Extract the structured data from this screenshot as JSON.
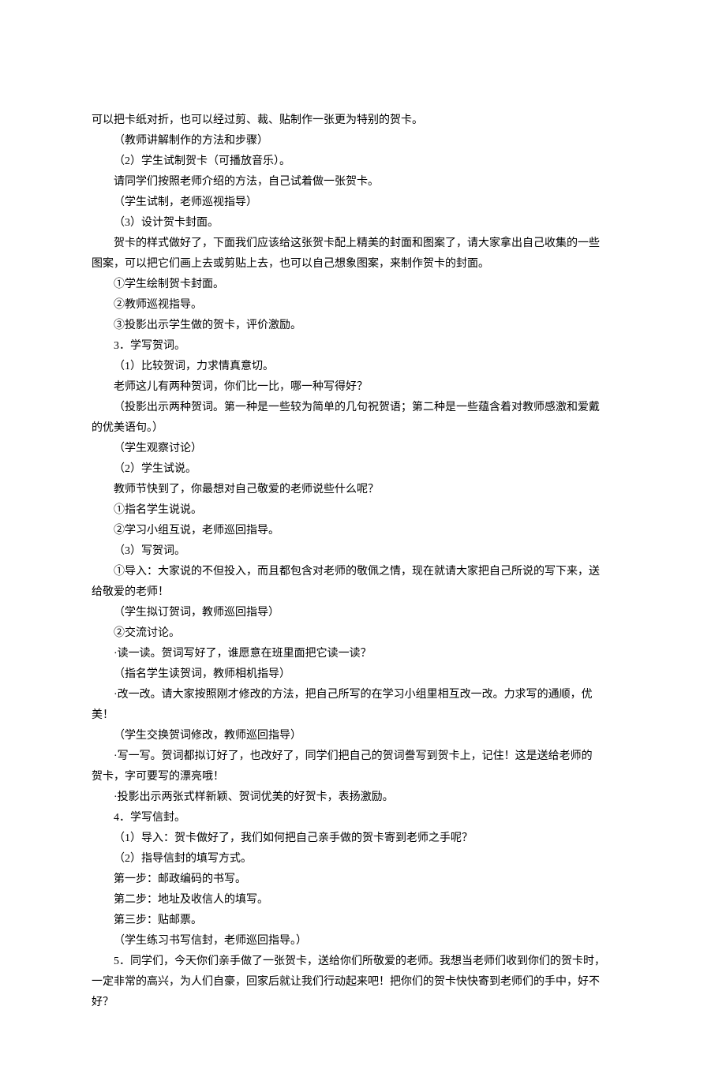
{
  "lines": [
    {
      "indent": "i0",
      "text": "可以把卡纸对折，也可以经过剪、裁、贴制作一张更为特别的贺卡。"
    },
    {
      "indent": "i2",
      "text": "（教师讲解制作的方法和步骤）"
    },
    {
      "indent": "i2",
      "text": "（2）学生试制贺卡（可播放音乐）。"
    },
    {
      "indent": "i2",
      "text": "请同学们按照老师介绍的方法，自己试着做一张贺卡。"
    },
    {
      "indent": "i2",
      "text": "（学生试制，老师巡视指导）"
    },
    {
      "indent": "i2",
      "text": "（3）设计贺卡封面。"
    },
    {
      "indent": "i2",
      "text": "贺卡的样式做好了，下面我们应该给这张贺卡配上精美的封面和图案了，请大家拿出自己收集的一些"
    },
    {
      "indent": "i0",
      "text": "图案，可以把它们画上去或剪贴上去，也可以自己想象图案，来制作贺卡的封面。"
    },
    {
      "indent": "i2",
      "text": "①学生绘制贺卡封面。"
    },
    {
      "indent": "i2",
      "text": "②教师巡视指导。"
    },
    {
      "indent": "i2",
      "text": "③投影出示学生做的贺卡，评价激励。"
    },
    {
      "indent": "i2",
      "text": "3．学写贺词。"
    },
    {
      "indent": "i2",
      "text": "（1）比较贺词，力求情真意切。"
    },
    {
      "indent": "i2",
      "text": "老师这儿有两种贺词，你们比一比，哪一种写得好？"
    },
    {
      "indent": "i2",
      "text": "（投影出示两种贺词。第一种是一些较为简单的几句祝贺语；第二种是一些蕴含着对教师感激和爱戴"
    },
    {
      "indent": "i0",
      "text": "的优美语句。）"
    },
    {
      "indent": "i2",
      "text": "（学生观察讨论）"
    },
    {
      "indent": "i2",
      "text": "（2）学生试说。"
    },
    {
      "indent": "i2",
      "text": "教师节快到了，你最想对自己敬爱的老师说些什么呢？"
    },
    {
      "indent": "i2",
      "text": "①指名学生说说。"
    },
    {
      "indent": "i2",
      "text": "②学习小组互说，老师巡回指导。"
    },
    {
      "indent": "i2",
      "text": "（3）写贺词。"
    },
    {
      "indent": "i2",
      "text": "①导入：大家说的不但投入，而且都包含对老师的敬佩之情，现在就请大家把自己所说的写下来，送"
    },
    {
      "indent": "i0",
      "text": "给敬爱的老师！"
    },
    {
      "indent": "i2",
      "text": "（学生拟订贺词，教师巡回指导）"
    },
    {
      "indent": "i2",
      "text": "②交流讨论。"
    },
    {
      "indent": "i2",
      "text": "·读一读。贺词写好了，谁愿意在班里面把它读一读？"
    },
    {
      "indent": "i2",
      "text": "（指名学生读贺词，教师相机指导）"
    },
    {
      "indent": "i2",
      "text": "·改一改。请大家按照刚才修改的方法，把自己所写的在学习小组里相互改一改。力求写的通顺，优"
    },
    {
      "indent": "i0",
      "text": "美！"
    },
    {
      "indent": "i2",
      "text": "（学生交换贺词修改，教师巡回指导）"
    },
    {
      "indent": "i2",
      "text": "·写一写。贺词都拟订好了，也改好了，同学们把自己的贺词誊写到贺卡上，记住！这是送给老师的"
    },
    {
      "indent": "i0",
      "text": "贺卡，字可要写的漂亮哦！"
    },
    {
      "indent": "i2",
      "text": "·投影出示两张式样新颖、贺词优美的好贺卡，表扬激励。"
    },
    {
      "indent": "i2",
      "text": "4．学写信封。"
    },
    {
      "indent": "i2",
      "text": "（1）导入：贺卡做好了，我们如何把自己亲手做的贺卡寄到老师之手呢？"
    },
    {
      "indent": "i2",
      "text": "（2）指导信封的填写方式。"
    },
    {
      "indent": "i2",
      "text": "第一步：邮政编码的书写。"
    },
    {
      "indent": "i2",
      "text": "第二步：地址及收信人的填写。"
    },
    {
      "indent": "i2",
      "text": "第三步：贴邮票。"
    },
    {
      "indent": "i2",
      "text": "（学生练习书写信封，老师巡回指导。）"
    },
    {
      "indent": "i2",
      "text": "5．同学们，今天你们亲手做了一张贺卡，送给你们所敬爱的老师。我想当老师们收到你们的贺卡时，"
    },
    {
      "indent": "i0",
      "text": "一定非常的高兴，为人们自豪，回家后就让我们行动起来吧！把你们的贺卡快快寄到老师们的手中，好不"
    },
    {
      "indent": "i0",
      "text": "好？"
    }
  ]
}
